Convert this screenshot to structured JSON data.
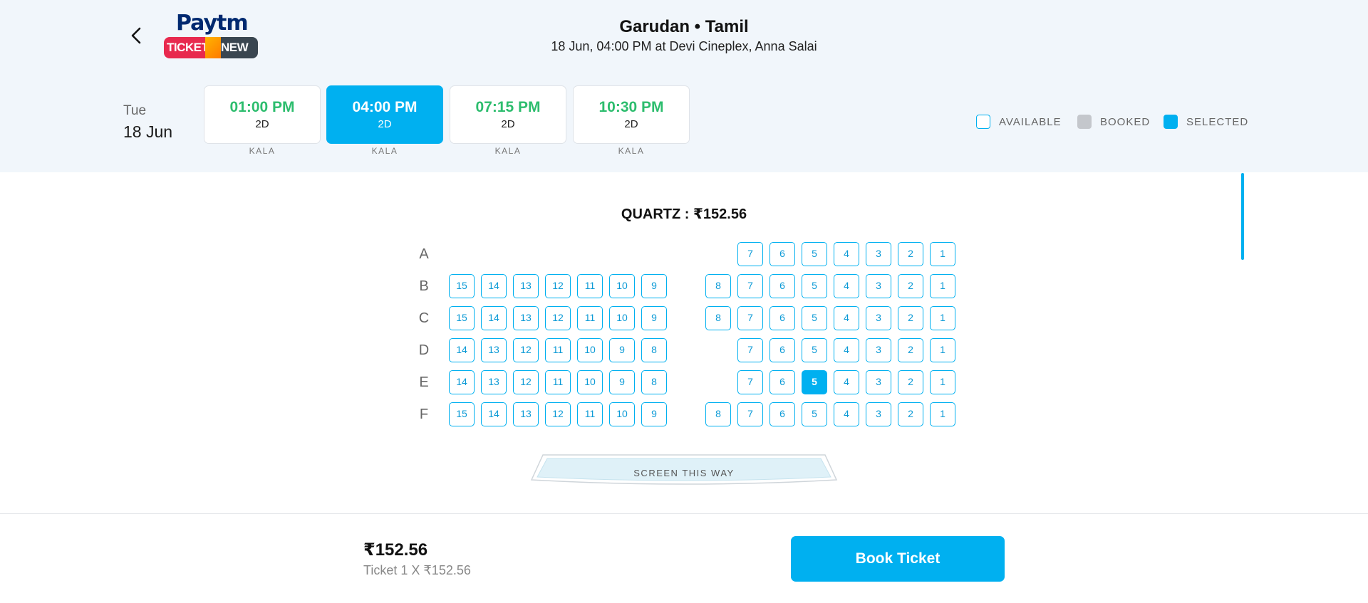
{
  "header": {
    "logo": {
      "brand": "Paytm",
      "sub_left": "TICKET",
      "sub_right": "NEW"
    },
    "movie_title": "Garudan • Tamil",
    "show_info": "18 Jun, 04:00 PM at Devi Cineplex, Anna Salai"
  },
  "date": {
    "day": "Tue",
    "date": "18 Jun"
  },
  "showtimes": [
    {
      "time": "01:00 PM",
      "format": "2D",
      "venue": "KALA"
    },
    {
      "time": "04:00 PM",
      "format": "2D",
      "venue": "KALA",
      "selected": true
    },
    {
      "time": "07:15 PM",
      "format": "2D",
      "venue": "KALA"
    },
    {
      "time": "10:30 PM",
      "format": "2D",
      "venue": "KALA"
    }
  ],
  "legend": {
    "available": "AVAILABLE",
    "booked": "BOOKED",
    "selected": "SELECTED"
  },
  "colors": {
    "accent": "#00b0f0",
    "time_green": "#2dbd6e",
    "booked_gray": "#c4c7cc",
    "header_bg": "#f1f6fb"
  },
  "seat_map": {
    "heading": "QUARTZ : ₹152.56",
    "rows": [
      {
        "label": "A",
        "left": [],
        "right": [
          "7",
          "6",
          "5",
          "4",
          "3",
          "2",
          "1"
        ]
      },
      {
        "label": "B",
        "left": [
          "15",
          "14",
          "13",
          "12",
          "11",
          "10",
          "9"
        ],
        "right": [
          "8",
          "7",
          "6",
          "5",
          "4",
          "3",
          "2",
          "1"
        ]
      },
      {
        "label": "C",
        "left": [
          "15",
          "14",
          "13",
          "12",
          "11",
          "10",
          "9"
        ],
        "right": [
          "8",
          "7",
          "6",
          "5",
          "4",
          "3",
          "2",
          "1"
        ]
      },
      {
        "label": "D",
        "left": [
          "14",
          "13",
          "12",
          "11",
          "10",
          "9",
          "8"
        ],
        "right": [
          "7",
          "6",
          "5",
          "4",
          "3",
          "2",
          "1"
        ]
      },
      {
        "label": "E",
        "left": [
          "14",
          "13",
          "12",
          "11",
          "10",
          "9",
          "8"
        ],
        "right": [
          "7",
          "6",
          "5",
          "4",
          "3",
          "2",
          "1"
        ],
        "selected_seat": "5"
      },
      {
        "label": "F",
        "left": [
          "15",
          "14",
          "13",
          "12",
          "11",
          "10",
          "9"
        ],
        "right": [
          "8",
          "7",
          "6",
          "5",
          "4",
          "3",
          "2",
          "1"
        ]
      }
    ],
    "screen_label": "SCREEN THIS WAY"
  },
  "footer": {
    "total": "₹152.56",
    "breakdown": "Ticket 1 X ₹152.56",
    "book_label": "Book Ticket"
  }
}
